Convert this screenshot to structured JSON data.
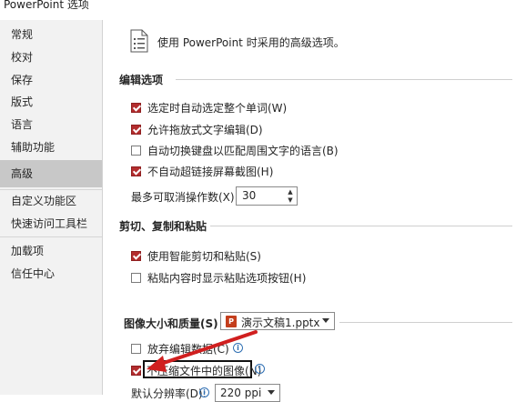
{
  "window": {
    "title": "PowerPoint 选项"
  },
  "sidebar": {
    "items": [
      {
        "label": "常规"
      },
      {
        "label": "校对"
      },
      {
        "label": "保存"
      },
      {
        "label": "版式"
      },
      {
        "label": "语言"
      },
      {
        "label": "辅助功能"
      },
      {
        "label": "高级",
        "active": true
      },
      {
        "label": "自定义功能区"
      },
      {
        "label": "快速访问工具栏"
      },
      {
        "label": "加载项"
      },
      {
        "label": "信任中心"
      }
    ]
  },
  "main": {
    "header": {
      "icon": "document-options-icon",
      "title": "使用 PowerPoint 时采用的高级选项。"
    },
    "editing": {
      "title": "编辑选项",
      "options": [
        {
          "label": "选定时自动选定整个单词(W)",
          "checked": true
        },
        {
          "label": "允许拖放式文字编辑(D)",
          "checked": true
        },
        {
          "label": "自动切换键盘以匹配周围文字的语言(B)",
          "checked": false
        },
        {
          "label": "不自动超链接屏幕截图(H)",
          "checked": true
        }
      ],
      "undo_label": "最多可取消操作数(X):",
      "undo_value": "30"
    },
    "clipboard": {
      "title": "剪切、复制和粘贴",
      "options": [
        {
          "label": "使用智能剪切和粘贴(S)",
          "checked": true
        },
        {
          "label": "粘贴内容时显示粘贴选项按钮(H)",
          "checked": false
        }
      ]
    },
    "image": {
      "title": "图像大小和质量(S)",
      "file_value": "演示文稿1.pptx",
      "options": [
        {
          "label": "放弃编辑数据(C)",
          "checked": false
        },
        {
          "label": "不压缩文件中的图像(N)",
          "checked": true
        }
      ],
      "resolution_label": "默认分辨率(D):",
      "resolution_value": "220 ppi"
    }
  },
  "colors": {
    "checkbox": "#b32d2e",
    "annotation_arrow": "#d01f1f",
    "active_nav": "#c8c8c8"
  }
}
